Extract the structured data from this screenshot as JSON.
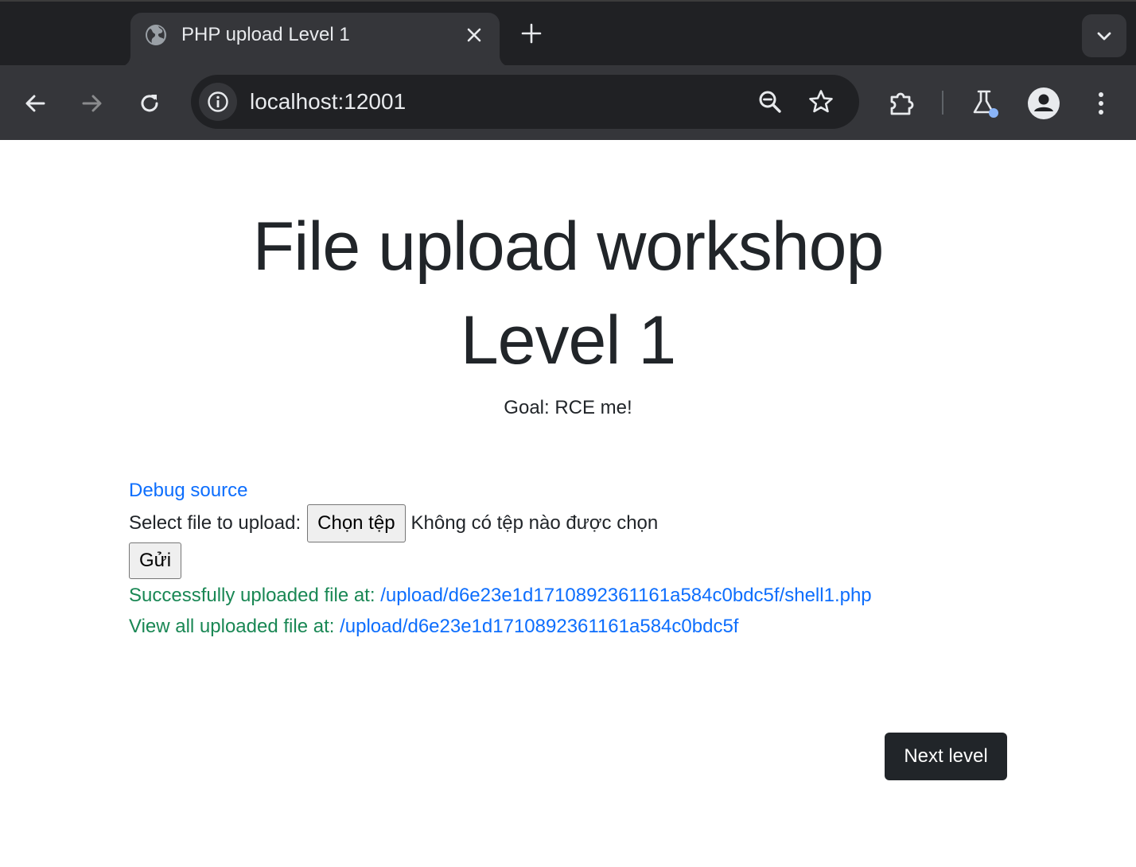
{
  "browser": {
    "tab_title": "PHP upload Level 1",
    "url": "localhost:12001",
    "icons": {
      "tab_favicon": "globe-icon",
      "tab_close": "close-icon",
      "new_tab": "plus-icon",
      "tab_search": "chevron-down-icon",
      "back": "arrow-left-icon",
      "forward": "arrow-right-icon",
      "reload": "reload-icon",
      "site_info": "info-icon",
      "zoom": "zoom-out-icon",
      "bookmark": "star-icon",
      "extensions": "puzzle-icon",
      "labs": "flask-icon",
      "profile": "profile-icon",
      "menu": "kebab-menu-icon"
    }
  },
  "page": {
    "title_line1": "File upload workshop",
    "title_line2": "Level 1",
    "goal": "Goal: RCE me!",
    "debug_link": "Debug source",
    "select_label": "Select file to upload:",
    "choose_file_button": "Chọn tệp",
    "no_file_text": "Không có tệp nào được chọn",
    "submit_button": "Gửi",
    "success_label": "Successfully uploaded file at:",
    "success_link": "/upload/d6e23e1d1710892361161a584c0bdc5f/shell1.php",
    "view_all_label": "View all uploaded file at:",
    "view_all_link": "/upload/d6e23e1d1710892361161a584c0bdc5f",
    "next_level_button": "Next level"
  },
  "colors": {
    "link": "#0d6efd",
    "success": "#198754",
    "text": "#212529",
    "dark_button": "#212529",
    "chrome_dark": "#202124",
    "chrome_toolbar": "#35363a"
  }
}
